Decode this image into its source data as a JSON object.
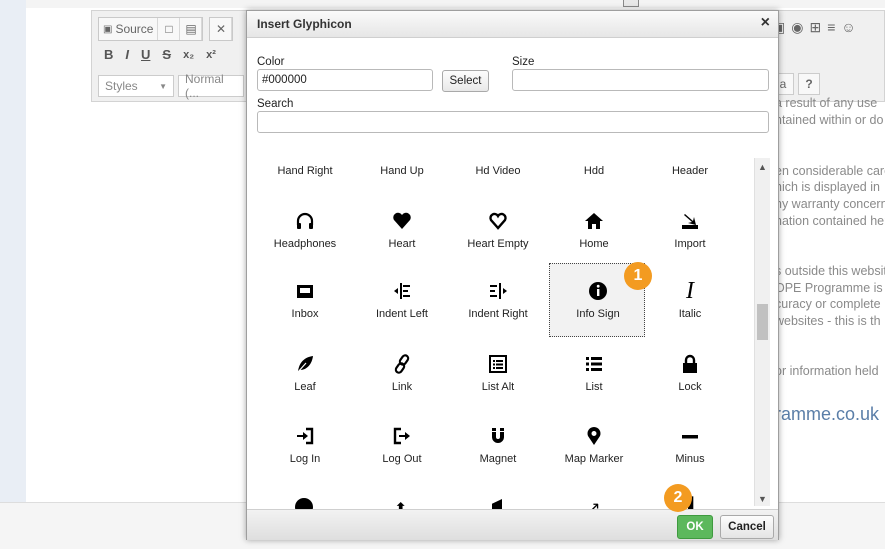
{
  "editor": {
    "toolbar": {
      "source_label": "Source",
      "styles_label": "Styles",
      "format_label": "Normal (...",
      "bold": "B",
      "italic": "I",
      "underline": "U",
      "strike": "S",
      "subscript": "x₂",
      "superscript": "x²",
      "help": "?",
      "partial_a": "a"
    },
    "background_text": [
      "a result of any use",
      "ntained within or do",
      "en considerable care",
      "hich is displayed in",
      "ny warranty concern",
      "nation contained here",
      "s outside this website",
      "OPE Programme is",
      "curacy or complete",
      "websites - this is th",
      "or information held",
      "ramme.co.uk"
    ]
  },
  "dialog": {
    "title": "Insert Glyphicon",
    "close": "×",
    "color_label": "Color",
    "color_value": "#000000",
    "select_button": "Select",
    "size_label": "Size",
    "size_value": "",
    "search_label": "Search",
    "search_value": "",
    "header_row": [
      "Hand Right",
      "Hand Up",
      "Hd Video",
      "Hdd",
      "Header"
    ],
    "glyph_rows": [
      [
        {
          "label": "Headphones",
          "icon": "headphones-icon",
          "glyph": "🎧"
        },
        {
          "label": "Heart",
          "icon": "heart-icon",
          "glyph": "♥"
        },
        {
          "label": "Heart Empty",
          "icon": "heart-empty-icon",
          "glyph": "♡"
        },
        {
          "label": "Home",
          "icon": "home-icon",
          "glyph": "⌂"
        },
        {
          "label": "Import",
          "icon": "import-icon",
          "glyph": "⤓"
        }
      ],
      [
        {
          "label": "Inbox",
          "icon": "inbox-icon",
          "glyph": "▣"
        },
        {
          "label": "Indent Left",
          "icon": "indent-left-icon",
          "glyph": "⇤"
        },
        {
          "label": "Indent Right",
          "icon": "indent-right-icon",
          "glyph": "⇥"
        },
        {
          "label": "Info Sign",
          "icon": "info-sign-icon",
          "glyph": "ℹ"
        },
        {
          "label": "Italic",
          "icon": "italic-icon",
          "glyph": "I"
        }
      ],
      [
        {
          "label": "Leaf",
          "icon": "leaf-icon",
          "glyph": "❦"
        },
        {
          "label": "Link",
          "icon": "link-icon",
          "glyph": "∞"
        },
        {
          "label": "List Alt",
          "icon": "list-alt-icon",
          "glyph": "▤"
        },
        {
          "label": "List",
          "icon": "list-icon",
          "glyph": "☰"
        },
        {
          "label": "Lock",
          "icon": "lock-icon",
          "glyph": "▲"
        }
      ],
      [
        {
          "label": "Log In",
          "icon": "log-in-icon",
          "glyph": "⇲"
        },
        {
          "label": "Log Out",
          "icon": "log-out-icon",
          "glyph": "⇱"
        },
        {
          "label": "Magnet",
          "icon": "magnet-icon",
          "glyph": "∪"
        },
        {
          "label": "Map Marker",
          "icon": "map-marker-icon",
          "glyph": "⚲"
        },
        {
          "label": "Minus",
          "icon": "minus-icon",
          "glyph": "−"
        }
      ]
    ],
    "selected_glyph": "Info Sign",
    "ok_button": "OK",
    "cancel_button": "Cancel"
  },
  "annotations": {
    "step1": "1",
    "step2": "2",
    "badge_color": "#f39b21"
  },
  "colors": {
    "ok_green": "#5cb85c"
  }
}
